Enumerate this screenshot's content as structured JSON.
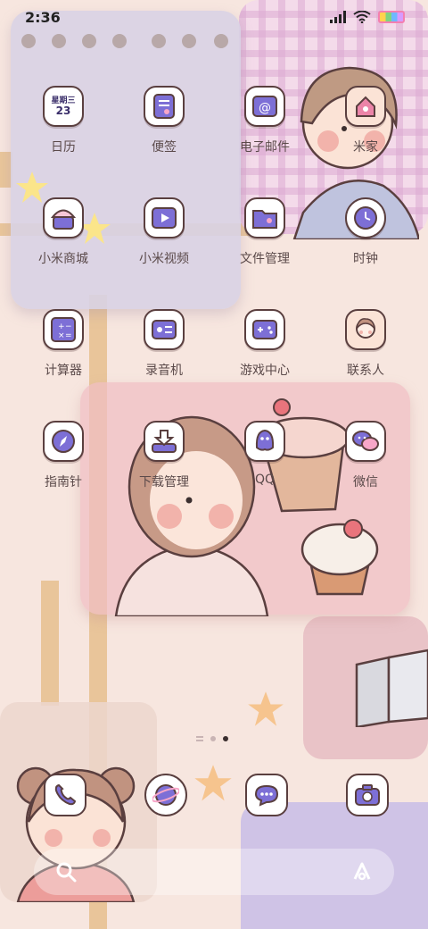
{
  "status_bar": {
    "time": "2:36"
  },
  "apps": [
    {
      "label": "日历",
      "icon": "calendar-icon",
      "calendar_day": "星期三",
      "calendar_date": "23"
    },
    {
      "label": "便签",
      "icon": "notes-icon"
    },
    {
      "label": "电子邮件",
      "icon": "email-icon"
    },
    {
      "label": "米家",
      "icon": "smart-home-icon"
    },
    {
      "label": "小米商城",
      "icon": "store-icon"
    },
    {
      "label": "小米视频",
      "icon": "video-icon"
    },
    {
      "label": "文件管理",
      "icon": "file-manager-icon"
    },
    {
      "label": "时钟",
      "icon": "clock-icon"
    },
    {
      "label": "计算器",
      "icon": "calculator-icon"
    },
    {
      "label": "录音机",
      "icon": "recorder-icon"
    },
    {
      "label": "游戏中心",
      "icon": "game-center-icon"
    },
    {
      "label": "联系人",
      "icon": "contacts-icon"
    },
    {
      "label": "指南针",
      "icon": "compass-icon"
    },
    {
      "label": "下载管理",
      "icon": "download-icon"
    },
    {
      "label": "QQ",
      "icon": "qq-icon"
    },
    {
      "label": "微信",
      "icon": "wechat-icon"
    }
  ],
  "dock": [
    {
      "icon": "phone-icon"
    },
    {
      "icon": "browser-icon"
    },
    {
      "icon": "messages-icon"
    },
    {
      "icon": "camera-icon"
    }
  ],
  "pager": {
    "pages": 2,
    "active": 2
  },
  "colors": {
    "icon_fill": "#7d6fd6",
    "icon_outline": "#5a3f3f",
    "label": "#5b4a4a"
  }
}
